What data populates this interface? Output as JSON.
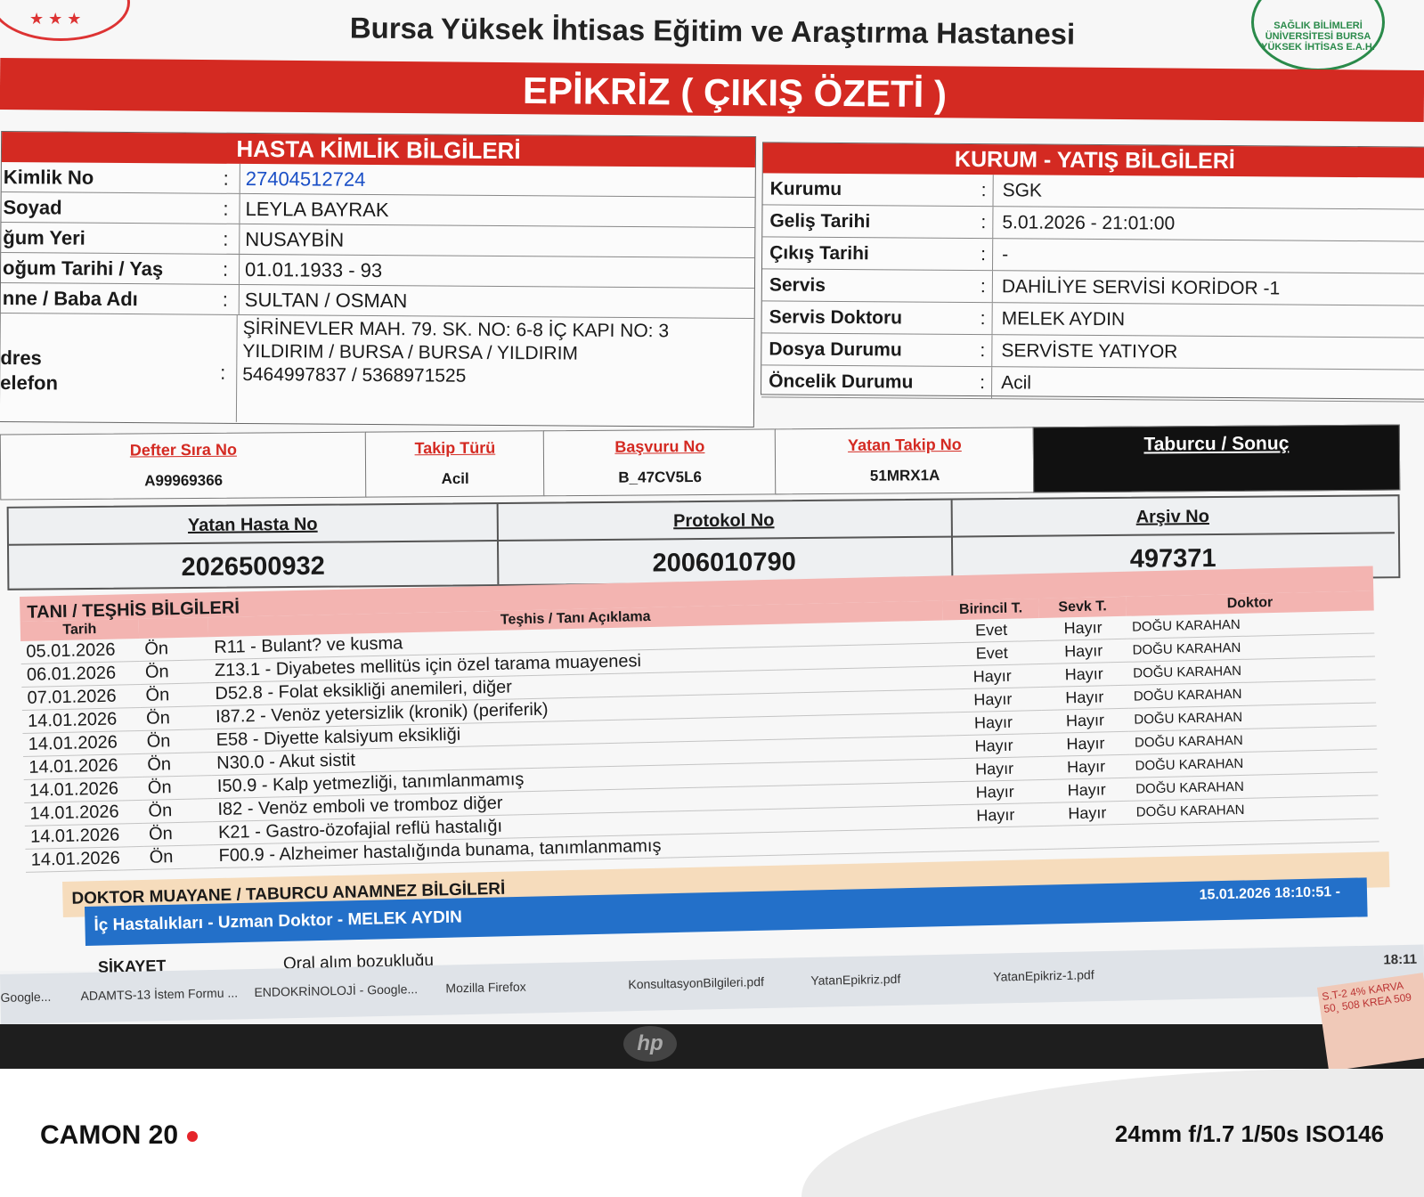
{
  "header": {
    "hospital_name": "Bursa Yüksek İhtisas Eğitim ve Araştırma Hastanesi",
    "doc_title": "EPİKRİZ ( ÇIKIŞ ÖZETİ )",
    "seal_text": "SAĞLIK BİLİMLERİ ÜNİVERSİTESİ BURSA YÜKSEK İHTİSAS E.A.H."
  },
  "patient": {
    "section_title": "HASTA KİMLİK BİLGİLERİ",
    "rows": [
      {
        "label": "Kimlik No",
        "value": "27404512724"
      },
      {
        "label": "Soyad",
        "value": "LEYLA BAYRAK"
      },
      {
        "label": "ğum Yeri",
        "value": "NUSAYBİN"
      },
      {
        "label": "oğum Tarihi / Yaş",
        "value": "01.01.1933 - 93"
      },
      {
        "label": "nne / Baba Adı",
        "value": "SULTAN / OSMAN"
      }
    ],
    "address_label": "dres",
    "phone_label": "elefon",
    "address_line1": "ŞİRİNEVLER MAH. 79. SK. NO: 6-8  İÇ KAPI NO: 3",
    "address_line2": "YILDIRIM / BURSA / BURSA / YILDIRIM",
    "phones": "5464997837 / 5368971525",
    "colon": ":"
  },
  "institution": {
    "section_title": "KURUM - YATIŞ BİLGİLERİ",
    "rows": [
      {
        "label": "Kurumu",
        "value": "SGK"
      },
      {
        "label": "Geliş Tarihi",
        "value": "5.01.2026 - 21:01:00"
      },
      {
        "label": "Çıkış Tarihi",
        "value": "-"
      },
      {
        "label": "Servis",
        "value": "DAHİLİYE SERVİSİ KORİDOR -1"
      },
      {
        "label": "Servis Doktoru",
        "value": "MELEK AYDIN"
      },
      {
        "label": "Dosya Durumu",
        "value": "SERVİSTE YATIYOR"
      },
      {
        "label": "Öncelik Durumu",
        "value": "Acil"
      }
    ]
  },
  "tracking": [
    {
      "label": "Defter Sıra No",
      "value": "A99969366"
    },
    {
      "label": "Takip Türü",
      "value": "Acil"
    },
    {
      "label": "Başvuru No",
      "value": "B_47CV5L6"
    },
    {
      "label": "Yatan Takip No",
      "value": "51MRX1A"
    },
    {
      "label": "Taburcu / Sonuç",
      "value": ""
    }
  ],
  "numbers": [
    {
      "label": "Yatan Hasta No",
      "value": "2026500932"
    },
    {
      "label": "Protokol No",
      "value": "2006010790"
    },
    {
      "label": "Arşiv No",
      "value": "497371"
    }
  ],
  "diagnosis": {
    "section_title": "TANI / TEŞHİS BİLGİLERİ",
    "columns": {
      "date": "Tarih",
      "desc": "Teşhis / Tanı Açıklama",
      "primary": "Birincil T.",
      "referral": "Sevk T.",
      "doctor": "Doktor"
    },
    "rows": [
      {
        "date": "05.01.2026",
        "type": "Ön",
        "desc": "R11 - Bulant? ve kusma",
        "primary": "Evet",
        "referral": "Hayır",
        "doctor": "DOĞU KARAHAN"
      },
      {
        "date": "06.01.2026",
        "type": "Ön",
        "desc": "Z13.1 - Diyabetes mellitüs için özel tarama muayenesi",
        "primary": "Evet",
        "referral": "Hayır",
        "doctor": "DOĞU KARAHAN"
      },
      {
        "date": "07.01.2026",
        "type": "Ön",
        "desc": "D52.8 - Folat eksikliği anemileri, diğer",
        "primary": "Hayır",
        "referral": "Hayır",
        "doctor": "DOĞU KARAHAN"
      },
      {
        "date": "14.01.2026",
        "type": "Ön",
        "desc": "I87.2 - Venöz yetersizlik (kronik) (periferik)",
        "primary": "Hayır",
        "referral": "Hayır",
        "doctor": "DOĞU KARAHAN"
      },
      {
        "date": "14.01.2026",
        "type": "Ön",
        "desc": "E58 - Diyette kalsiyum eksikliği",
        "primary": "Hayır",
        "referral": "Hayır",
        "doctor": "DOĞU KARAHAN"
      },
      {
        "date": "14.01.2026",
        "type": "Ön",
        "desc": "N30.0 - Akut sistit",
        "primary": "Hayır",
        "referral": "Hayır",
        "doctor": "DOĞU KARAHAN"
      },
      {
        "date": "14.01.2026",
        "type": "Ön",
        "desc": "I50.9 - Kalp yetmezliği, tanımlanmamış",
        "primary": "Hayır",
        "referral": "Hayır",
        "doctor": "DOĞU KARAHAN"
      },
      {
        "date": "14.01.2026",
        "type": "Ön",
        "desc": "I82 - Venöz emboli ve tromboz diğer",
        "primary": "Hayır",
        "referral": "Hayır",
        "doctor": "DOĞU KARAHAN"
      },
      {
        "date": "14.01.2026",
        "type": "Ön",
        "desc": "K21 - Gastro-özofajial reflü hastalığı",
        "primary": "Hayır",
        "referral": "Hayır",
        "doctor": "DOĞU KARAHAN"
      },
      {
        "date": "14.01.2026",
        "type": "Ön",
        "desc": "F00.9 - Alzheimer hastalığında bunama, tanımlanmamış",
        "primary": "",
        "referral": "",
        "doctor": ""
      }
    ]
  },
  "anamnesis": {
    "section_title": "DOKTOR MUAYANE /  TABURCU ANAMNEZ BİLGİLERİ",
    "doctor_line": "İç Hastalıkları - Uzman Doktor - MELEK AYDIN",
    "timestamp": "15.01.2026 18:10:51 -",
    "complaint_label": "ŞİKAYET",
    "complaint_value": "Oral alım bozukluğu"
  },
  "taskbar": {
    "items": [
      "Google...",
      "ADAMTS-13 İstem Formu ...",
      "ENDOKRİNOLOJİ - Google...",
      "Mozilla Firefox",
      "KonsultasyonBilgileri.pdf",
      "YatanEpikriz.pdf",
      "YatanEpikriz-1.pdf"
    ],
    "clock": "18:11"
  },
  "note_text": "S.T-2 4% KARVA 50¸ 508 KREA 509",
  "device": {
    "brand": "hp"
  },
  "camera": {
    "model": "CAMON 20",
    "specs": "24mm f/1.7 1/50s ISO146"
  }
}
